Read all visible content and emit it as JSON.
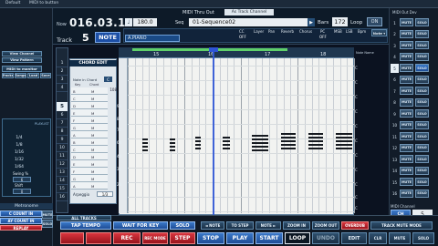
{
  "titlebar": {
    "default": "Default",
    "midi_to_button": "MIDI to button"
  },
  "header": {
    "now_label": "Now",
    "position": "016.03.17",
    "track_label": "Track",
    "track_number": "5",
    "mode": "NOTE",
    "tempo": "180.0",
    "seq_label": "Seq",
    "sequence_name": "01-Sequence02",
    "bars_label": "Bars",
    "bars_value": "172",
    "loop_label": "Loop",
    "loop_value": "ON",
    "midi_thru": "MIDI Thru Out",
    "as_track_channel": "As Track Channel",
    "instrument": "A.PIANO",
    "midi_out_dev": "MIDI Out Dev",
    "params": [
      "CC",
      "Layer",
      "Pan",
      "Reverb",
      "Chorus",
      "PC",
      "MSB",
      "LSB",
      "Bpm"
    ],
    "param_values": [
      "OFF",
      "",
      "",
      "",
      "",
      "OFF",
      "",
      "",
      ""
    ],
    "note_tab": "Note ▾"
  },
  "left_panel": {
    "midi_to_monitor": "MIDI to monitor",
    "tracks": "Tracks",
    "songs": "Songs",
    "load": "Load",
    "save": "Save",
    "view_channel": "View Channel",
    "view_pattern": "View Pattern",
    "playlist": "PLAYLIST",
    "tracks_list": [
      "1/4",
      "1/8",
      "1/16",
      "1/32",
      "1/64"
    ],
    "swing_label": "Swing %",
    "swing_value": "6",
    "shift_label": "Shift",
    "shift_value": "0",
    "metronome": "Metronome",
    "c_count_in": "C COUNT IN",
    "ay_count_in": "AY COUNT IN",
    "replay": "REPLAY",
    "mute": "MUTE",
    "solo": "SOLO"
  },
  "track_column": {
    "numbers": [
      "1",
      "2",
      "3",
      "4",
      "5",
      "6",
      "7",
      "8",
      "9",
      "10",
      "11",
      "12",
      "13",
      "14",
      "15",
      "16"
    ],
    "active": "5"
  },
  "chord_panel": {
    "title": "CHORD EDIT",
    "header": "Note in Chord",
    "header_badge": "C",
    "columns": [
      "Key",
      "Chord"
    ],
    "rows": [
      {
        "key": "B",
        "chord": "M"
      },
      {
        "key": "C",
        "chord": "M"
      },
      {
        "key": "D",
        "chord": "M"
      },
      {
        "key": "E",
        "chord": "M"
      },
      {
        "key": "F",
        "chord": "M"
      },
      {
        "key": "G",
        "chord": "M"
      },
      {
        "key": "A",
        "chord": "M"
      },
      {
        "key": "B",
        "chord": "M"
      },
      {
        "key": "C",
        "chord": "M"
      },
      {
        "key": "D",
        "chord": "M"
      },
      {
        "key": "E",
        "chord": "M"
      },
      {
        "key": "F",
        "chord": "M"
      },
      {
        "key": "G",
        "chord": "M"
      },
      {
        "key": "A",
        "chord": "M"
      },
      {
        "key": "B",
        "chord": "M"
      }
    ],
    "arpeggio_label": "Arpeggio",
    "arpeggio_value": "1/3"
  },
  "piano_roll": {
    "bar_numbers": [
      "15",
      "16",
      "17",
      "18"
    ],
    "pitch_labels": [
      "108",
      "96",
      "84",
      "72",
      "60",
      "48",
      "36",
      "24"
    ],
    "end_markers": [
      "C",
      "C",
      "C",
      "C",
      "C",
      "C",
      "C",
      "C",
      "C",
      "C",
      "C"
    ],
    "right_label": "Note Name"
  },
  "right_panel": {
    "title": "MIDI Out Dev",
    "tracks": [
      "1",
      "2",
      "3",
      "4",
      "5",
      "6",
      "7",
      "8",
      "9",
      "10",
      "11",
      "12",
      "13",
      "14",
      "15",
      "16"
    ],
    "active": "5",
    "mute": "MUTE",
    "solo": "SOLO",
    "midi_channel": "MIDI Channel",
    "ch": "CH",
    "channel_value": "5"
  },
  "bottom_bar": {
    "all_tracks": "ALL TRACKS",
    "tap_tempo": "TAP TEMPO",
    "wait_for_key": "WAIT FOR KEY",
    "solo": "SOLO",
    "note_back": "◄ NOTE",
    "to_step": "TO STEP",
    "note_fwd": "NOTE ►",
    "zoom_in": "ZOOM IN",
    "zoom_out": "ZOOM OUT",
    "overdub": "OVERDUB",
    "track_mute_mode": "TRACK MUTE MODE",
    "undo": "UNDO",
    "rec": "REC",
    "rec_mode": "REC MODE",
    "step": "STEP",
    "stop": "STOP",
    "play": "PLAY",
    "start": "START",
    "loop": "LOOP",
    "edit": "EDIT",
    "clr": "CLR",
    "mute": "MUTE",
    "solo2": "SOLO"
  },
  "colors": {
    "background": "#0b1220",
    "accent_blue": "#2c6ad0",
    "record_red": "#d8343d",
    "grid_paper": "#f2f3f1",
    "playhead": "#2e55d6"
  }
}
